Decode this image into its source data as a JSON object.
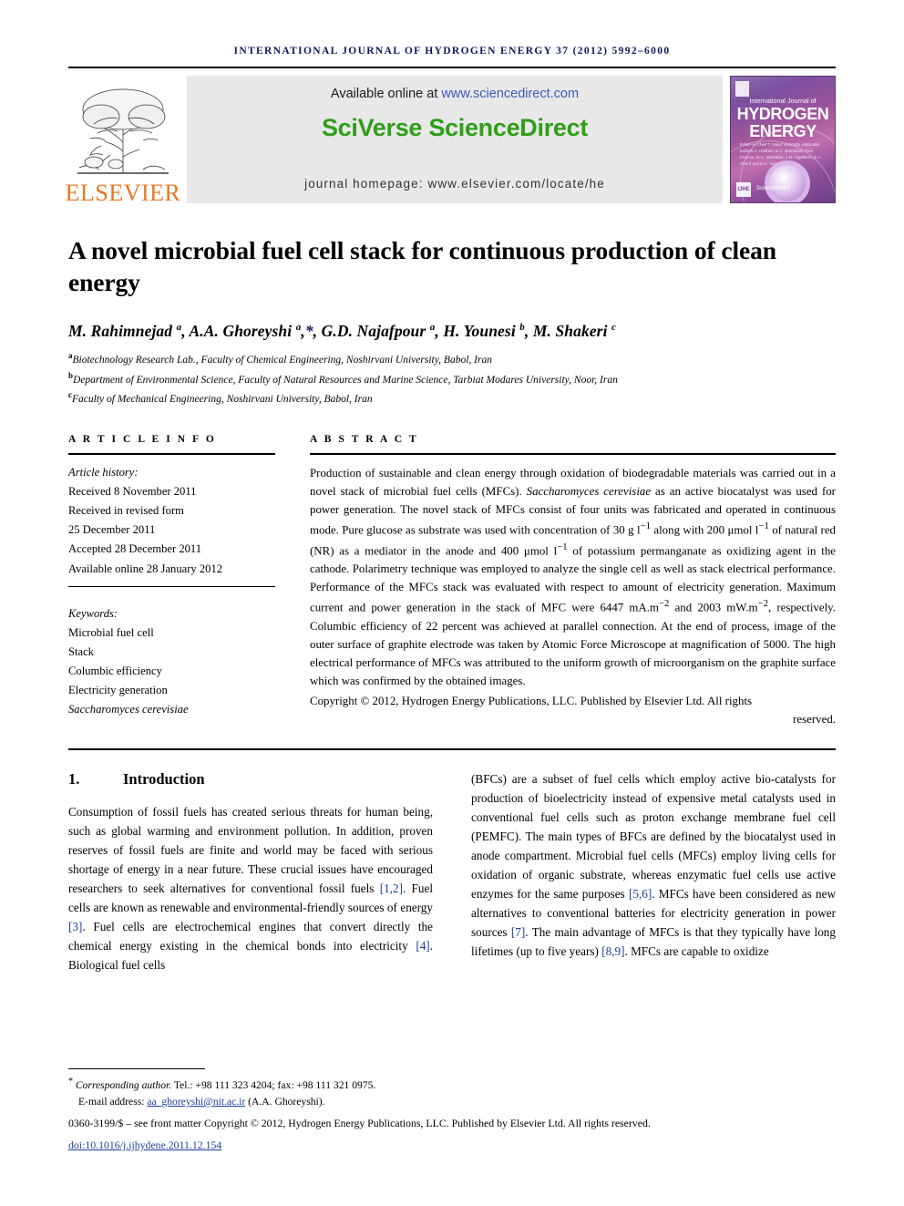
{
  "running_head": "INTERNATIONAL JOURNAL OF HYDROGEN ENERGY 37 (2012) 5992–6000",
  "masthead": {
    "publisher_name": "ELSEVIER",
    "available_prefix": "Available online at ",
    "available_url": "www.sciencedirect.com",
    "platform": "SciVerse ScienceDirect",
    "homepage": "journal homepage: www.elsevier.com/locate/he",
    "cover": {
      "line1": "International Journal of",
      "line2": "HYDROGEN",
      "line3": "ENERGY",
      "editors": "Editor-in-Chief  T. Nejat Veziroglu    Associate Editors  A. Hashmi, E.C. Brandson, Rick Francis, M.C. Momirlan, J.M. Ogelthon, S.A. Sherif and E.A. Vermeulen",
      "sciencedirect": "ScienceDirect",
      "badge": "IJHE"
    }
  },
  "article": {
    "title": "A novel microbial fuel cell stack for continuous production of clean energy",
    "authors_html": "M. Rahimnejad <sup>a</sup>, A.A. Ghoreyshi <sup>a</sup>,<span class=\"star\">*</span>, G.D. Najafpour <sup>a</sup>, H. Younesi <sup>b</sup>, M. Shakeri <sup>c</sup>",
    "affiliations": [
      {
        "mark": "a",
        "text": "Biotechnology Research Lab., Faculty of Chemical Engineering, Noshirvani University, Babol, Iran"
      },
      {
        "mark": "b",
        "text": "Department of Environmental Science, Faculty of Natural Resources and Marine Science, Tarbiat Modares University, Noor, Iran"
      },
      {
        "mark": "c",
        "text": "Faculty of Mechanical Engineering, Noshirvani University, Babol, Iran"
      }
    ]
  },
  "article_info": {
    "heading": "A R T I C L E   I N F O",
    "history_label": "Article history:",
    "history": [
      "Received 8 November 2011",
      "Received in revised form",
      "25 December 2011",
      "Accepted 28 December 2011",
      "Available online 28 January 2012"
    ],
    "keywords_label": "Keywords:",
    "keywords": [
      {
        "text": "Microbial fuel cell",
        "italic": false
      },
      {
        "text": "Stack",
        "italic": false
      },
      {
        "text": "Columbic efficiency",
        "italic": false
      },
      {
        "text": "Electricity generation",
        "italic": false
      },
      {
        "text": "Saccharomyces cerevisiae",
        "italic": true
      }
    ]
  },
  "abstract": {
    "heading": "A B S T R A C T",
    "body_html": "Production of sustainable and clean energy through oxidation of biodegradable materials was carried out in a novel stack of microbial fuel cells (MFCs). <span class=\"ital\">Saccharomyces cerevisiae</span> as an active biocatalyst was used for power generation. The novel stack of MFCs consist of four units was fabricated and operated in continuous mode. Pure glucose as substrate was used with concentration of 30 g l<sup>&minus;1</sup> along with 200 &mu;mol l<sup>&minus;1</sup> of natural red (NR) as a mediator in the anode and 400 &mu;mol l<sup>&minus;1</sup> of potassium permanganate as oxidizing agent in the cathode. Polarimetry technique was employed to analyze the single cell as well as stack electrical performance. Performance of the MFCs stack was evaluated with respect to amount of electricity generation. Maximum current and power generation in the stack of MFC were 6447 mA.m<sup>&minus;2</sup> and 2003 mW.m<sup>&minus;2</sup>, respectively. Columbic efficiency of 22 percent was achieved at parallel connection. At the end of process, image of the outer surface of graphite electrode was taken by Atomic Force Microscope at magnification of 5000. The high electrical performance of MFCs was attributed to the uniform growth of microorganism on the graphite surface which was confirmed by the obtained images.",
    "copyright": "Copyright © 2012, Hydrogen Energy Publications, LLC. Published by Elsevier Ltd. All rights",
    "copyright_last": "reserved."
  },
  "sections": {
    "intro_number": "1.",
    "intro_title": "Introduction",
    "left_column_html": "Consumption of fossil fuels has created serious threats for human being, such as global warming and environment pollution. In addition, proven reserves of fossil fuels are finite and world may be faced with serious shortage of energy in a near future. These crucial issues have encouraged researchers to seek alternatives for conventional fossil fuels <span class=\"ref\">[1,2]</span>. Fuel cells are known as renewable and environmental-friendly sources of energy <span class=\"ref\">[3]</span>. Fuel cells are electrochemical engines that convert directly the chemical energy existing in the chemical bonds into electricity <span class=\"ref\">[4]</span>. Biological fuel cells",
    "right_column_html": "(BFCs) are a subset of fuel cells which employ active bio-catalysts for production of bioelectricity instead of expensive metal catalysts used in conventional fuel cells such as proton exchange membrane fuel cell (PEMFC). The main types of BFCs are defined by the biocatalyst used in anode compartment. Microbial fuel cells (MFCs) employ living cells for oxidation of organic substrate, whereas enzymatic fuel cells use active enzymes for the same purposes <span class=\"ref\">[5,6]</span>. MFCs have been considered as new alternatives to conventional batteries for electricity generation in power sources <span class=\"ref\">[7]</span>. The main advantage of MFCs is that they typically have long lifetimes (up to five years) <span class=\"ref\">[8,9]</span>. MFCs are capable to oxidize"
  },
  "footer": {
    "corresponding_html": "<span class=\"star\">*</span> <span class=\"corr\">Corresponding author.</span> Tel.: +98 111 323 4204; fax: +98 111 321 0975.",
    "email_label": "E-mail address: ",
    "email": "aa_ghoreyshi@nit.ac.ir",
    "email_suffix": " (A.A. Ghoreyshi).",
    "issn_line": "0360-3199/$ – see front matter Copyright © 2012, Hydrogen Energy Publications, LLC. Published by Elsevier Ltd. All rights reserved.",
    "doi": "doi:10.1016/j.ijhydene.2011.12.154"
  },
  "colors": {
    "running_head": "#0d1a5c",
    "elsevier_orange": "#e87722",
    "sciencedirect_green": "#2f9e18",
    "link_blue": "#1a3fa0",
    "banner_gray": "#e8e8e8"
  }
}
